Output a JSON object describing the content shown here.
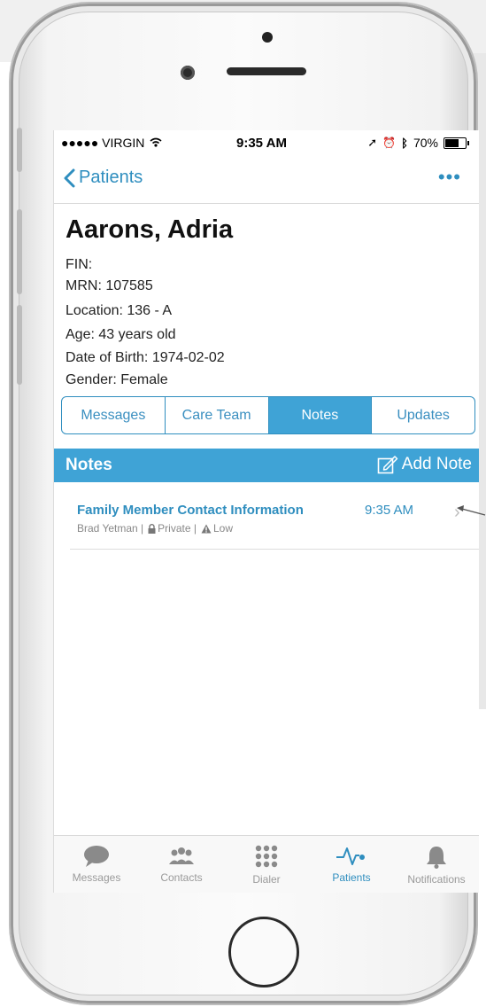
{
  "status": {
    "carrier": "●●●●● VIRGIN",
    "time": "9:35 AM",
    "battery": "70%",
    "battery_level": 0.7
  },
  "nav": {
    "back_label": "Patients",
    "more_label": "•••"
  },
  "patient": {
    "name": "Aarons, Adria",
    "fin": "FIN:",
    "mrn": "MRN: 107585",
    "location": "Location: 136 - A",
    "age": "Age: 43 years old",
    "dob": "Date of Birth: 1974-02-02",
    "gender": "Gender: Female"
  },
  "tabs": [
    {
      "label": "Messages",
      "active": false
    },
    {
      "label": "Care Team",
      "active": false
    },
    {
      "label": "Notes",
      "active": true
    },
    {
      "label": "Updates",
      "active": false
    }
  ],
  "notes_section": {
    "title": "Notes",
    "add_label": "Add Note"
  },
  "notes": [
    {
      "title": "Family Member Contact Information",
      "author": "Brad Yetman |",
      "privacy": "Private |",
      "priority": "Low",
      "time": "9:35 AM"
    }
  ],
  "tabbar": [
    {
      "label": "Messages",
      "icon": "chat-bubble-icon"
    },
    {
      "label": "Contacts",
      "icon": "people-icon"
    },
    {
      "label": "Dialer",
      "icon": "keypad-icon"
    },
    {
      "label": "Patients",
      "icon": "heartbeat-icon",
      "active": true
    },
    {
      "label": "Notifications",
      "icon": "bell-icon"
    }
  ],
  "colors": {
    "accent": "#3fa3d6",
    "link": "#2f8ebf",
    "muted": "#9a9a9a"
  }
}
